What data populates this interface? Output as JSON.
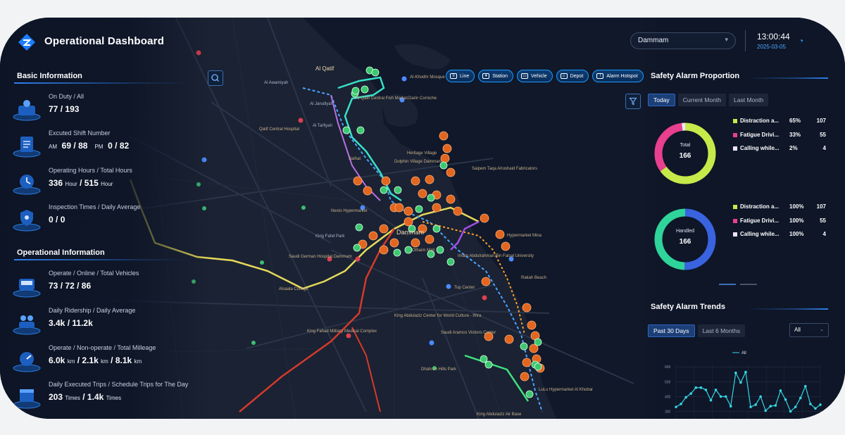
{
  "header": {
    "title": "Operational Dashboard",
    "city": "Dammam",
    "time": "13:00:44",
    "date": "2025-03-05"
  },
  "basic": {
    "title": "Basic Information",
    "items": [
      {
        "label": "On Duty  /  All",
        "v1": "77",
        "v2": "193"
      },
      {
        "label": "Excuted Shift Number",
        "p1": "AM",
        "v1": "69",
        "v2": "88",
        "p2": "PM",
        "v3": "0",
        "v4": "82"
      },
      {
        "label": "Operating Hours  /  Total Hours",
        "v1": "336",
        "u1": "Hour",
        "v2": "515",
        "u2": "Hour"
      },
      {
        "label": "Inspection Times  /  Daily Average",
        "v1": "0",
        "v2": "0"
      }
    ]
  },
  "operational": {
    "title": "Operational Information",
    "items": [
      {
        "label": "Operate  /  Online  /  Total Vehicles",
        "v1": "73",
        "v2": "72",
        "v3": "86"
      },
      {
        "label": "Daily Ridership  /  Daily Average",
        "v1": "3.4k",
        "v2": "11.2k"
      },
      {
        "label": "Operate  /  Non-operate  /  Total Milleage",
        "v1": "6.0k",
        "u1": "km",
        "v2": "2.1k",
        "u2": "km",
        "v3": "8.1k",
        "u3": "km"
      },
      {
        "label": "Daily Executed Trips  /  Schedule Trips for The Day",
        "v1": "203",
        "u1": "Times",
        "v2": "1.4k",
        "u2": "Times"
      }
    ]
  },
  "layers": [
    {
      "label": "Line",
      "icon": "line-icon"
    },
    {
      "label": "Station",
      "icon": "station-icon"
    },
    {
      "label": "Vehicle",
      "icon": "bus-icon"
    },
    {
      "label": "Depot",
      "icon": "depot-icon"
    },
    {
      "label": "Alarm Hotspot",
      "icon": "alarm-icon"
    }
  ],
  "safety_proportion": {
    "title": "Safety Alarm Proportion",
    "tabs": [
      "Today",
      "Current Month",
      "Last Month"
    ],
    "active_tab": "Today",
    "colors": {
      "distraction": "#c6ea4a",
      "fatigue": "#e83f8f",
      "calling": "#efe3ff",
      "handled": "#3a63e0",
      "handled_alt": "#2fd49a"
    },
    "total": {
      "label": "Total",
      "value": "166"
    },
    "handled": {
      "label": "Handled",
      "value": "166"
    },
    "legend_total": [
      {
        "name": "Distraction a...",
        "pct": "65%",
        "count": "107",
        "color": "#c6ea4a"
      },
      {
        "name": "Fatigue Drivi...",
        "pct": "33%",
        "count": "55",
        "color": "#e83f8f"
      },
      {
        "name": "Calling while...",
        "pct": "2%",
        "count": "4",
        "color": "#efe3ff"
      }
    ],
    "legend_handled": [
      {
        "name": "Distraction a...",
        "pct": "100%",
        "count": "107",
        "color": "#c6ea4a"
      },
      {
        "name": "Fatigue Drivi...",
        "pct": "100%",
        "count": "55",
        "color": "#e83f8f"
      },
      {
        "name": "Calling while...",
        "pct": "100%",
        "count": "4",
        "color": "#efe3ff"
      }
    ]
  },
  "safety_trends": {
    "title": "Safety Alarm Trends",
    "tabs": [
      "Past 30 Days",
      "Last 6 Months"
    ],
    "active_tab": "Past 30 Days",
    "filter": "All"
  },
  "chart_data": {
    "type": "line",
    "legend": [
      "All"
    ],
    "y_ticks": [
      "600",
      "500",
      "400",
      "300"
    ],
    "ylim": [
      250,
      620
    ],
    "series": [
      {
        "name": "All",
        "values": [
          330,
          350,
          395,
          420,
          460,
          460,
          445,
          375,
          445,
          400,
          400,
          335,
          560,
          495,
          565,
          330,
          345,
          400,
          305,
          335,
          340,
          440,
          380,
          300,
          330,
          390,
          470,
          350,
          320,
          345
        ]
      }
    ]
  },
  "map_labels": [
    "Al Qatif",
    "Qatif Central Hospital",
    "Al-Qatif Central Fish Market",
    "Darin Corniche",
    "Heritage Village",
    "Dolphin Village Dammam",
    "Saipem Taqa Alrushaid Fabricators",
    "Saihat",
    "Nesto Hypermarket",
    "Dammam",
    "Imam Abdulrahman Bin Faisal University",
    "Hypermarket Mina",
    "Rakah Beach",
    "Top Center",
    "Saudi German Hospital Dammam",
    "Othaim Mall",
    "Alsaala College",
    "King Fahad Military Medical Complex",
    "King Abdulaziz Center for World Culture - Ithra",
    "Saudi Aramco Visitors Center",
    "Dhahran Hills Park",
    "LuLu Hypermarket Al Khobar",
    "King Abdulaziz Air Base",
    "Al-Khodhr Mosque",
    "Al Awamiyah",
    "Al Jarudiyah",
    "King Fahd Park",
    "Al Tarfiyah"
  ]
}
